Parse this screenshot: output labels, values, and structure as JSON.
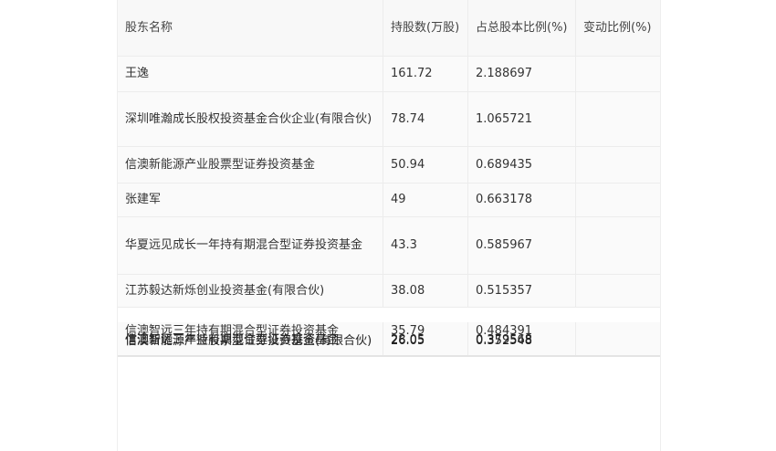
{
  "table": {
    "headers": [
      "股东名称",
      "持股数(万股)",
      "占总股本比例(%)",
      "变动比例(%)"
    ],
    "rows": [
      {
        "name": "王逸",
        "shares": "161.72",
        "ratio": "2.188697",
        "change": ""
      },
      {
        "name": "深圳唯瀚成长股权投资基金合伙企业(有限合伙)",
        "shares": "78.74",
        "ratio": "1.065721",
        "change": ""
      },
      {
        "name": "信澳新能源产业股票型证券投资基金",
        "shares": "50.94",
        "ratio": "0.689435",
        "change": ""
      },
      {
        "name": "张建军",
        "shares": "49",
        "ratio": "0.663178",
        "change": ""
      },
      {
        "name": "华夏远见成长一年持有期混合型证券投资基金",
        "shares": "43.3",
        "ratio": "0.585967",
        "change": ""
      },
      {
        "name": "江苏毅达新烁创业投资基金(有限合伙)",
        "shares": "38.08",
        "ratio": "0.515357",
        "change": ""
      },
      {
        "name": "信澳智远三年持有期混合型证券投资基金",
        "shares": "35.79",
        "ratio": "0.484391",
        "change": ""
      }
    ],
    "overlapped": {
      "name_a": "信澳智远三年持有期混合型证券投资基金",
      "name_b": "信澳新能源产业股票型证券投资基金(有限合伙)",
      "shares_a": "28.05",
      "shares_b": "26.05",
      "ratio_a": "0.379568",
      "ratio_b": "0.352548"
    }
  }
}
